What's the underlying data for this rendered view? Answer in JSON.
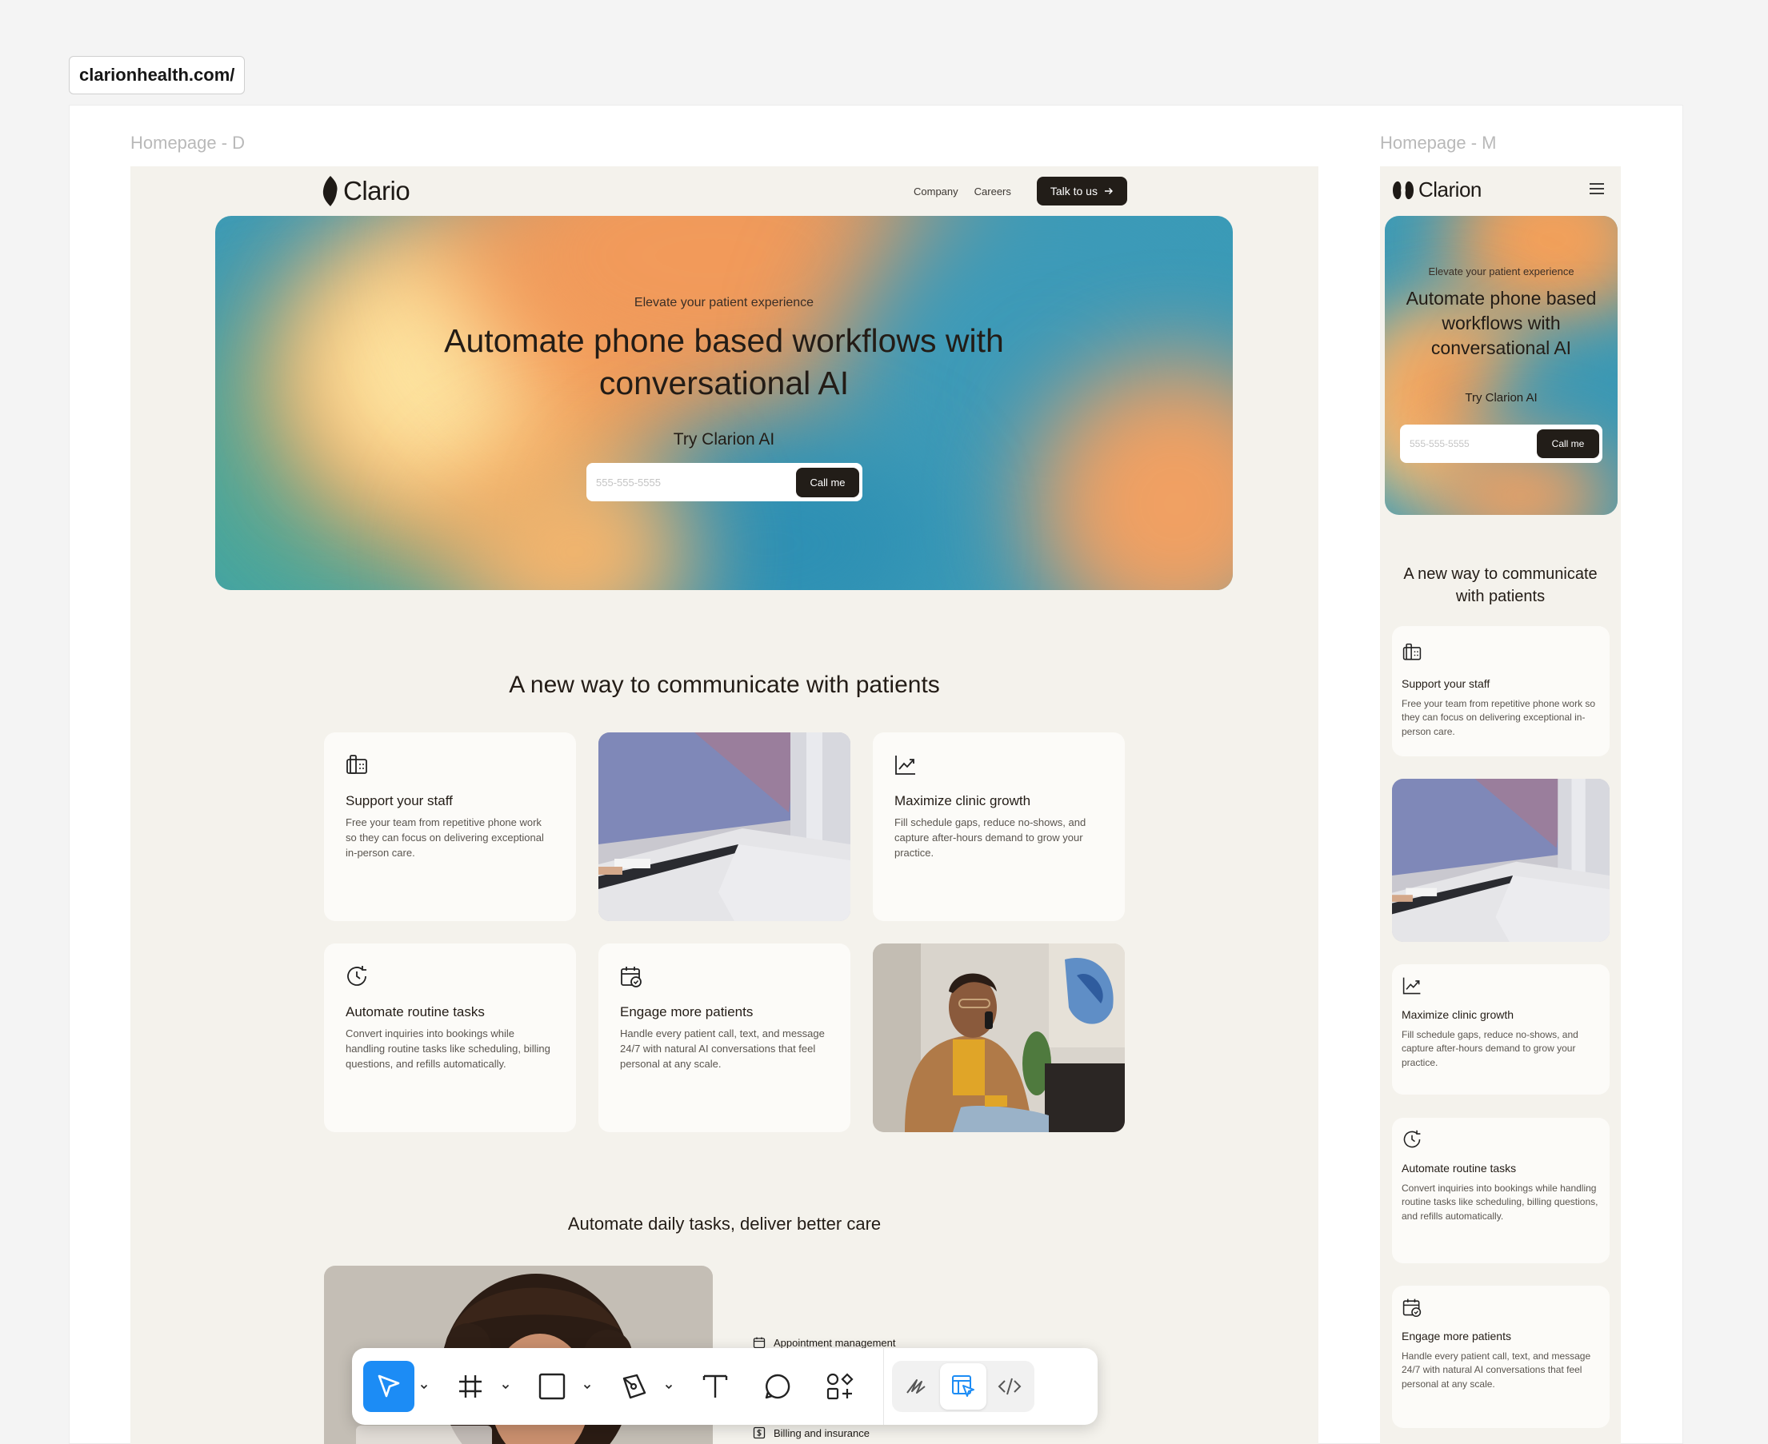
{
  "browser": {
    "url": "clarionhealth.com/"
  },
  "frames": {
    "desktop_label": "Homepage - D",
    "mobile_label": "Homepage - M"
  },
  "desktop": {
    "logo": "Clario",
    "nav": {
      "company": "Company",
      "careers": "Careers",
      "cta": "Talk to us"
    },
    "hero": {
      "eyebrow": "Elevate your patient experience",
      "title_line1": "Automate phone based workflows with",
      "title_line2": "conversational AI",
      "try_label": "Try Clarion AI",
      "phone_placeholder": "555-555-5555",
      "call_button": "Call me"
    },
    "features_title": "A new way to communicate with patients",
    "features": [
      {
        "title": "Support your staff",
        "body": "Free your team from repetitive phone work so they can focus on delivering exceptional in-person care.",
        "icon": "fax-icon"
      },
      {
        "title": "Maximize clinic growth",
        "body": "Fill schedule gaps, reduce no-shows, and capture after-hours demand to grow your practice.",
        "icon": "trend-up-icon"
      },
      {
        "title": "Automate routine tasks",
        "body": "Convert inquiries into bookings while handling routine tasks like scheduling, billing questions, and refills automatically.",
        "icon": "clock-refresh-icon"
      },
      {
        "title": "Engage more patients",
        "body": "Handle every patient call, text, and message 24/7 with natural AI conversations that feel personal at any scale.",
        "icon": "calendar-check-icon"
      }
    ],
    "tasks_title": "Automate daily tasks, deliver better care",
    "tasks": [
      "Appointment management",
      "Billing and insurance"
    ]
  },
  "mobile": {
    "logo": "Clarion",
    "hero": {
      "eyebrow": "Elevate your patient experience",
      "title_line1": "Automate phone based",
      "title_line2": "workflows with",
      "title_line3": "conversational AI",
      "try_label": "Try Clarion AI",
      "phone_placeholder": "555-555-5555",
      "call_button": "Call me"
    },
    "features_title_line1": "A new way to communicate",
    "features_title_line2": "with patients",
    "features": [
      {
        "title": "Support your staff",
        "body": "Free your team from repetitive phone work so they can focus on delivering exceptional in-person care."
      },
      {
        "title": "Maximize clinic growth",
        "body": "Fill schedule gaps, reduce no-shows, and capture after-hours demand to grow your practice."
      },
      {
        "title": "Automate routine tasks",
        "body": "Convert inquiries into bookings while handling routine tasks like scheduling, billing questions, and refills automatically."
      },
      {
        "title": "Engage more patients",
        "body": "Handle every patient call, text, and message 24/7 with natural AI conversations that feel personal at any scale."
      }
    ]
  },
  "toolbar": {
    "tools": [
      "move-tool",
      "frame-tool",
      "shape-tool",
      "pen-tool",
      "text-tool",
      "comment-tool",
      "actions-tool"
    ],
    "modes": [
      "draw-mode",
      "design-mode",
      "dev-mode"
    ],
    "active_tool": "move-tool",
    "active_mode": "design-mode"
  },
  "colors": {
    "accent": "#1c8cf5",
    "dark_button": "#221d18",
    "page_bg": "#f4f2ec",
    "card_bg": "#fcfbf8"
  }
}
